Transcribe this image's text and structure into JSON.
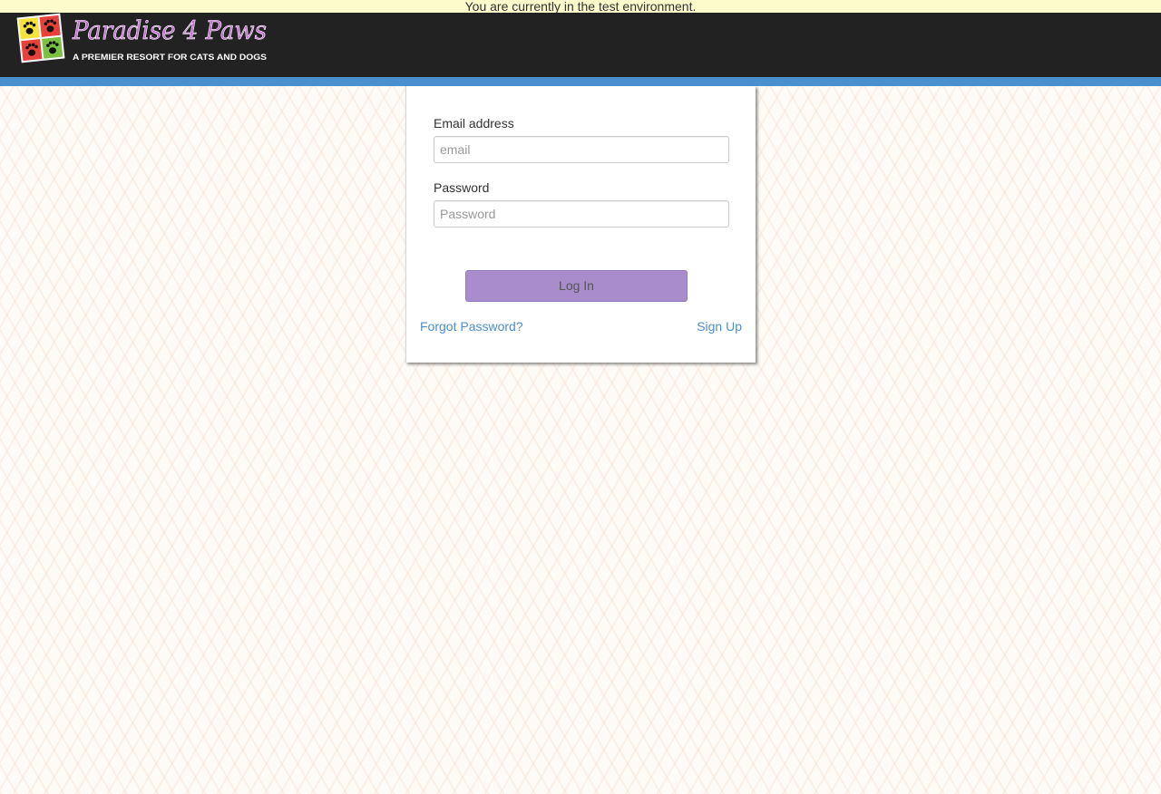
{
  "environment_banner": {
    "text": "You are currently in the test environment."
  },
  "header": {
    "logo": {
      "name": "Paradise 4 Paws",
      "tagline": "A PREMIER RESORT FOR CATS AND DOGS",
      "icon": "paw-quad-logo-icon"
    }
  },
  "login_form": {
    "email": {
      "label": "Email address",
      "placeholder": "email",
      "value": ""
    },
    "password": {
      "label": "Password",
      "placeholder": "Password",
      "value": ""
    },
    "login_button_label": "Log In",
    "forgot_password_link": "Forgot Password?",
    "sign_up_link": "Sign Up"
  },
  "colors": {
    "banner_bg": "#fdfbcc",
    "navbar_bg": "#222222",
    "stripe": "#4a8fce",
    "button_bg": "#a98ccc",
    "link": "#4a8fce",
    "logo_text": "#c36fd1"
  }
}
